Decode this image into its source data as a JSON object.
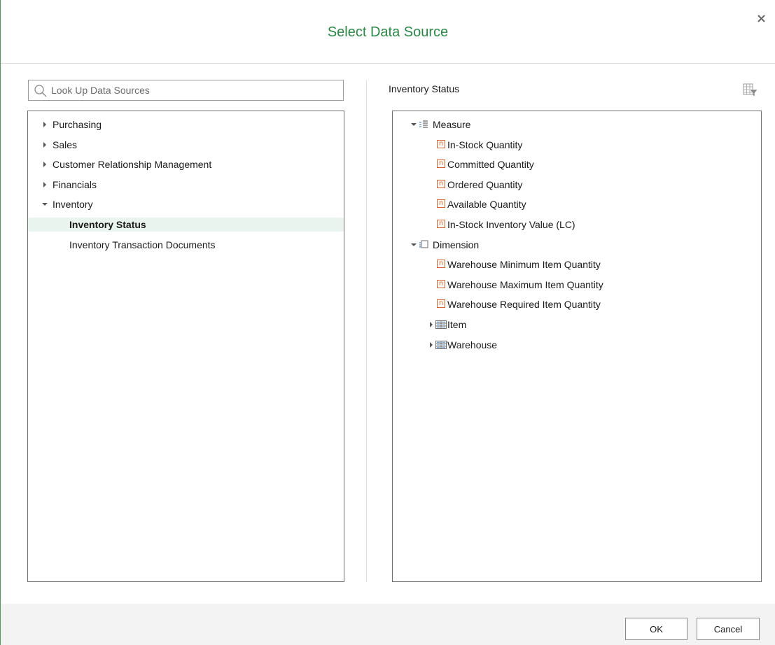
{
  "dialog": {
    "title": "Select Data Source",
    "accent_color": "#2a8a45"
  },
  "search": {
    "placeholder": "Look Up Data Sources",
    "value": ""
  },
  "left_tree": {
    "items": [
      {
        "label": "Purchasing",
        "state": "collapsed"
      },
      {
        "label": "Sales",
        "state": "collapsed"
      },
      {
        "label": "Customer Relationship Management",
        "state": "collapsed"
      },
      {
        "label": "Financials",
        "state": "collapsed"
      },
      {
        "label": "Inventory",
        "state": "expanded",
        "children": [
          {
            "label": "Inventory Status",
            "selected": true
          },
          {
            "label": "Inventory Transaction Documents",
            "selected": false
          }
        ]
      }
    ],
    "selected_color": "#eaf4ef"
  },
  "right_panel": {
    "title": "Inventory Status",
    "tree": {
      "measure": {
        "label": "Measure",
        "icon": "measure-icon",
        "children": [
          "In-Stock Quantity",
          "Committed Quantity",
          "Ordered Quantity",
          "Available Quantity",
          "In-Stock Inventory Value (LC)"
        ]
      },
      "dimension": {
        "label": "Dimension",
        "icon": "dimension-icon",
        "fields": [
          "Warehouse Minimum Item Quantity",
          "Warehouse Maximum Item Quantity",
          "Warehouse Required Item Quantity"
        ],
        "groups": [
          "Item",
          "Warehouse"
        ]
      }
    },
    "field_icon_glyph": "n",
    "field_icon_color": "#d9622b"
  },
  "footer": {
    "ok_label": "OK",
    "cancel_label": "Cancel"
  }
}
